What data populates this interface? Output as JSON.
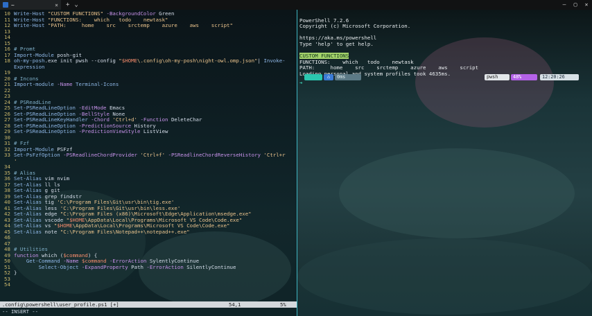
{
  "tabs": {
    "title": "~",
    "close": "×",
    "new_tab": "+",
    "dropdown": "⌄"
  },
  "window": {
    "minimize": "—",
    "maximize": "▢",
    "close": "✕"
  },
  "editor": {
    "lines": [
      {
        "n": "10",
        "tokens": [
          [
            "cmd",
            "Write-Host "
          ],
          [
            "str",
            "\"CUSTOM FUNCTIONS\""
          ],
          [
            "param",
            " -BackgroundColor"
          ],
          [
            "plain",
            " Green"
          ]
        ]
      },
      {
        "n": "11",
        "tokens": [
          [
            "cmd",
            "Write-Host "
          ],
          [
            "str",
            "\"FUNCTIONS:    which   todo    newtask\""
          ]
        ]
      },
      {
        "n": "12",
        "tokens": [
          [
            "cmd",
            "Write-Host "
          ],
          [
            "str",
            "\"PATH:     home    src    srctemp    azure    aws    script\""
          ]
        ]
      },
      {
        "n": "13",
        "tokens": []
      },
      {
        "n": "14",
        "tokens": []
      },
      {
        "n": "15",
        "tokens": []
      },
      {
        "n": "16",
        "tokens": [
          [
            "comment",
            "# Promt"
          ]
        ]
      },
      {
        "n": "17",
        "tokens": [
          [
            "cmd",
            "Import-Module"
          ],
          [
            "plain",
            " posh-git"
          ]
        ]
      },
      {
        "n": "18",
        "tokens": [
          [
            "cmd",
            "oh-my-posh"
          ],
          [
            "plain",
            ".exe init pwsh --config "
          ],
          [
            "str",
            "\""
          ],
          [
            "var",
            "$HOME"
          ],
          [
            "str",
            "\\.config\\oh-my-posh\\night-owl.omp.json\""
          ],
          [
            "plain",
            "| "
          ],
          [
            "cmd",
            "Invoke-"
          ]
        ]
      },
      {
        "n": "",
        "tokens": [
          [
            "cmd",
            "Expression"
          ]
        ]
      },
      {
        "n": "19",
        "tokens": []
      },
      {
        "n": "20",
        "tokens": [
          [
            "comment",
            "# Incons"
          ]
        ]
      },
      {
        "n": "21",
        "tokens": [
          [
            "cmd",
            "Import-module"
          ],
          [
            "param",
            " -Name"
          ],
          [
            "cmd",
            " Terminal-Icons"
          ]
        ]
      },
      {
        "n": "22",
        "tokens": []
      },
      {
        "n": "23",
        "tokens": []
      },
      {
        "n": "24",
        "tokens": [
          [
            "comment",
            "# PSReadLine"
          ]
        ]
      },
      {
        "n": "25",
        "tokens": [
          [
            "cmd",
            "Set-PSReadLineOption"
          ],
          [
            "param",
            " -EditMode"
          ],
          [
            "plain",
            " Emacs"
          ]
        ]
      },
      {
        "n": "26",
        "tokens": [
          [
            "cmd",
            "Set-PSReadLineOption"
          ],
          [
            "param",
            " -BellStyle"
          ],
          [
            "plain",
            " None"
          ]
        ]
      },
      {
        "n": "27",
        "tokens": [
          [
            "cmd",
            "Set-PSReadLineKeyHandler"
          ],
          [
            "param",
            " -Chord"
          ],
          [
            "str",
            " 'Ctrl+d'"
          ],
          [
            "param",
            " -Function"
          ],
          [
            "plain",
            " DeleteChar"
          ]
        ]
      },
      {
        "n": "28",
        "tokens": [
          [
            "cmd",
            "Set-PSReadLineOption"
          ],
          [
            "param",
            " -PredictionSource"
          ],
          [
            "plain",
            " History"
          ]
        ]
      },
      {
        "n": "29",
        "tokens": [
          [
            "cmd",
            "Set-PSReadLineOption"
          ],
          [
            "param",
            " -PredictionViewStyle"
          ],
          [
            "plain",
            " ListView"
          ]
        ]
      },
      {
        "n": "30",
        "tokens": []
      },
      {
        "n": "31",
        "tokens": [
          [
            "comment",
            "# Fzf"
          ]
        ]
      },
      {
        "n": "32",
        "tokens": [
          [
            "cmd",
            "Import-Module"
          ],
          [
            "plain",
            " PSFzf"
          ]
        ]
      },
      {
        "n": "33",
        "tokens": [
          [
            "cmd",
            "Set-PsFzfOption"
          ],
          [
            "param",
            " -PSReadlineChordProvider"
          ],
          [
            "str",
            " 'Ctrl+f'"
          ],
          [
            "param",
            " -PSReadlineChordReverseHistory"
          ],
          [
            "str",
            " 'Ctrl+r"
          ]
        ]
      },
      {
        "n": "",
        "tokens": [
          [
            "str",
            "'"
          ]
        ]
      },
      {
        "n": "34",
        "tokens": []
      },
      {
        "n": "35",
        "tokens": [
          [
            "comment",
            "# Alias"
          ]
        ]
      },
      {
        "n": "36",
        "tokens": [
          [
            "cmd",
            "Set-Alias"
          ],
          [
            "plain",
            " vim nvim"
          ]
        ]
      },
      {
        "n": "37",
        "tokens": [
          [
            "cmd",
            "Set-Alias"
          ],
          [
            "plain",
            " ll ls"
          ]
        ]
      },
      {
        "n": "38",
        "tokens": [
          [
            "cmd",
            "Set-Alias"
          ],
          [
            "plain",
            " g git"
          ]
        ]
      },
      {
        "n": "39",
        "tokens": [
          [
            "cmd",
            "Set-Alias"
          ],
          [
            "plain",
            " grep findstr"
          ]
        ]
      },
      {
        "n": "40",
        "tokens": [
          [
            "cmd",
            "Set-Alias"
          ],
          [
            "plain",
            " tig "
          ],
          [
            "str",
            "'C:\\Program Files\\Git\\usr\\bin\\tig.exe'"
          ]
        ]
      },
      {
        "n": "41",
        "tokens": [
          [
            "cmd",
            "Set-Alias"
          ],
          [
            "plain",
            " less "
          ],
          [
            "str",
            "'C:\\Program Files\\Git\\usr\\bin\\less.exe'"
          ]
        ]
      },
      {
        "n": "42",
        "tokens": [
          [
            "cmd",
            "Set-Alias"
          ],
          [
            "plain",
            " edge "
          ],
          [
            "str",
            "\"C:\\Program Files (x86)\\Microsoft\\Edge\\Application\\msedge.exe\""
          ]
        ]
      },
      {
        "n": "43",
        "tokens": [
          [
            "cmd",
            "Set-Alias"
          ],
          [
            "plain",
            " vscode "
          ],
          [
            "str",
            "\""
          ],
          [
            "var",
            "$HOME"
          ],
          [
            "str",
            "\\AppData\\Local\\Programs\\Microsoft VS Code\\Code.exe\""
          ]
        ]
      },
      {
        "n": "44",
        "tokens": [
          [
            "cmd",
            "Set-Alias"
          ],
          [
            "plain",
            " vs "
          ],
          [
            "str",
            "\""
          ],
          [
            "var",
            "$HOME"
          ],
          [
            "str",
            "\\AppData\\Local\\Programs\\Microsoft VS Code\\Code.exe\""
          ]
        ]
      },
      {
        "n": "45",
        "tokens": [
          [
            "cmd",
            "Set-Alias"
          ],
          [
            "plain",
            " note "
          ],
          [
            "str",
            "\"C:\\Program Files\\Notepad++\\notepad++.exe\""
          ]
        ]
      },
      {
        "n": "46",
        "tokens": []
      },
      {
        "n": "47",
        "tokens": []
      },
      {
        "n": "48",
        "tokens": [
          [
            "comment",
            "# Utilities"
          ]
        ]
      },
      {
        "n": "49",
        "tokens": [
          [
            "param",
            "function"
          ],
          [
            "plain",
            " which ("
          ],
          [
            "var",
            "$command"
          ],
          [
            "plain",
            ") {"
          ]
        ]
      },
      {
        "n": "50",
        "tokens": [
          [
            "plain",
            "    "
          ],
          [
            "cmd",
            "Get-Command"
          ],
          [
            "param",
            " -Name"
          ],
          [
            "var",
            " $command"
          ],
          [
            "param",
            " -ErrorAction"
          ],
          [
            "plain",
            " SylentlyContinue"
          ]
        ]
      },
      {
        "n": "51",
        "tokens": [
          [
            "plain",
            "        "
          ],
          [
            "cmd",
            "Select-Object"
          ],
          [
            "param",
            " -ExpandProperty"
          ],
          [
            "plain",
            " Path"
          ],
          [
            "param",
            " -ErrorAction"
          ],
          [
            "plain",
            " SilentlyContinue"
          ]
        ]
      },
      {
        "n": "52",
        "tokens": [
          [
            "plain",
            "}"
          ]
        ]
      },
      {
        "n": "53",
        "tokens": []
      },
      {
        "n": "54",
        "tokens": []
      }
    ],
    "status_file": ".config\\powershell\\user_profile.ps1 [+]",
    "status_pos": "54,1",
    "status_pct": "5%",
    "mode": "-- INSERT --"
  },
  "terminal": {
    "lines": [
      "PowerShell 7.2.6",
      "Copyright (c) Microsoft Corporation.",
      "",
      "https://aka.ms/powershell",
      "Type 'help' to get help.",
      "",
      "",
      "FUNCTIONS:    which   todo    newtask",
      "PATH:     home    src    srctemp    azure    aws    script",
      "Loading personal and system profiles took 4635ms."
    ],
    "custom_functions_label": "CUSTOM FUNCTIONS",
    "prompt_left_1": "",
    "prompt_left_2": "⌂",
    "prompt_left_3": "0ms",
    "prompt_user": "pwsh",
    "prompt_battery": "48%",
    "prompt_time": "12:20:26",
    "cursor": "➜"
  }
}
